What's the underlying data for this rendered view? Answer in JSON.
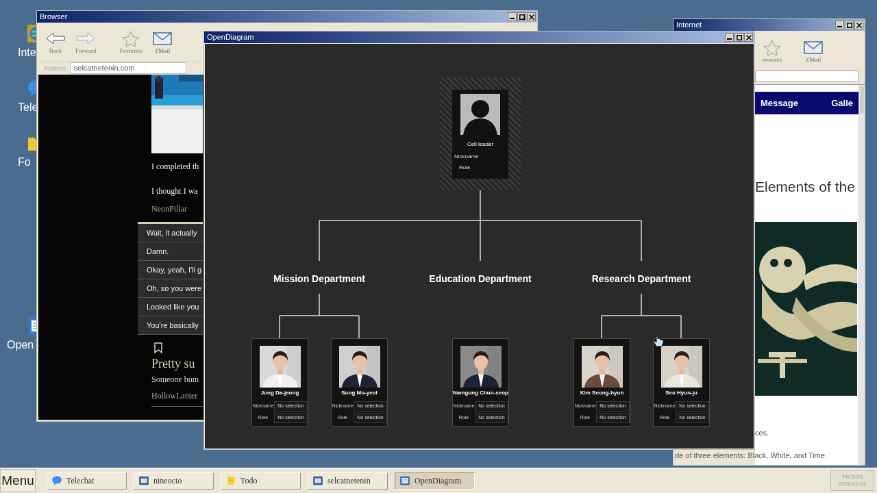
{
  "desktop_icons": [
    {
      "label": "Inte",
      "kind": "globe"
    },
    {
      "label": "Tele",
      "kind": "chat"
    },
    {
      "label": "Fo",
      "kind": "folder"
    },
    {
      "label": "Open",
      "kind": "document"
    }
  ],
  "browser": {
    "title": "Browser",
    "toolbar": [
      {
        "label": "Back",
        "kind": "back"
      },
      {
        "label": "Forward",
        "kind": "forward"
      },
      {
        "label": "Favorites",
        "kind": "favorites"
      },
      {
        "label": "ZMail",
        "kind": "mail"
      }
    ],
    "address_label": "Address",
    "address": "selcatnetenin.com",
    "posts": [
      "I completed th",
      "I thought I wa"
    ],
    "author": "NeonPillar",
    "replies": [
      "Wait, it actually",
      "Damn.",
      "Okay, yeah, I'll g",
      "Oh, so you were",
      "Looked like you",
      "You're basically"
    ],
    "post_title": "Pretty su",
    "post_text": "Someone bum",
    "post_author": "HollowLanter"
  },
  "diagram": {
    "title": "OpenDiagram",
    "leader": {
      "name": "Cell leader",
      "nickname_label": "Nickname",
      "role_label": "Role"
    },
    "departments": [
      {
        "name": "Mission Department",
        "members": [
          {
            "name": "Jung Da-jeong",
            "nickname_label": "Nickname",
            "nickname": "No selection",
            "role_label": "Role",
            "role": "No selection"
          },
          {
            "name": "Song Mu-yeol",
            "nickname_label": "Nickname",
            "nickname": "No selection",
            "role_label": "Role",
            "role": "No selection"
          }
        ]
      },
      {
        "name": "Education Department",
        "members": [
          {
            "name": "Namgung Chun-seop",
            "nickname_label": "Nickname",
            "nickname": "No selection",
            "role_label": "Role",
            "role": "No selection"
          }
        ]
      },
      {
        "name": "Research Department",
        "members": [
          {
            "name": "Kim Seong-hyun",
            "nickname_label": "Nickname",
            "nickname": "No selection",
            "role_label": "Role",
            "role": "No selection"
          },
          {
            "name": "Seo Hyun-ju",
            "nickname_label": "Nickname",
            "nickname": "No selection",
            "role_label": "Role",
            "role": "No selection"
          }
        ]
      }
    ]
  },
  "internet": {
    "title": "Internet",
    "toolbar": [
      {
        "label": "avorites",
        "kind": "favorites"
      },
      {
        "label": "ZMail",
        "kind": "mail"
      }
    ],
    "nav": [
      "Message",
      "Galle"
    ],
    "heading": "Elements of the",
    "text_1": "ces.",
    "text_2": "de of three elements: Black, White, and Time."
  },
  "taskbar": {
    "menu": "Menu",
    "tasks": [
      {
        "label": "Telechat",
        "kind": "chat",
        "selected": false
      },
      {
        "label": "nineocto",
        "kind": "app",
        "selected": false
      },
      {
        "label": "Todo",
        "kind": "note",
        "selected": false
      },
      {
        "label": "selcatnetenin",
        "kind": "app",
        "selected": false
      },
      {
        "label": "OpenDiagram",
        "kind": "diagram",
        "selected": true
      }
    ],
    "time": "PM 5:00",
    "date": "2026-01-02"
  }
}
